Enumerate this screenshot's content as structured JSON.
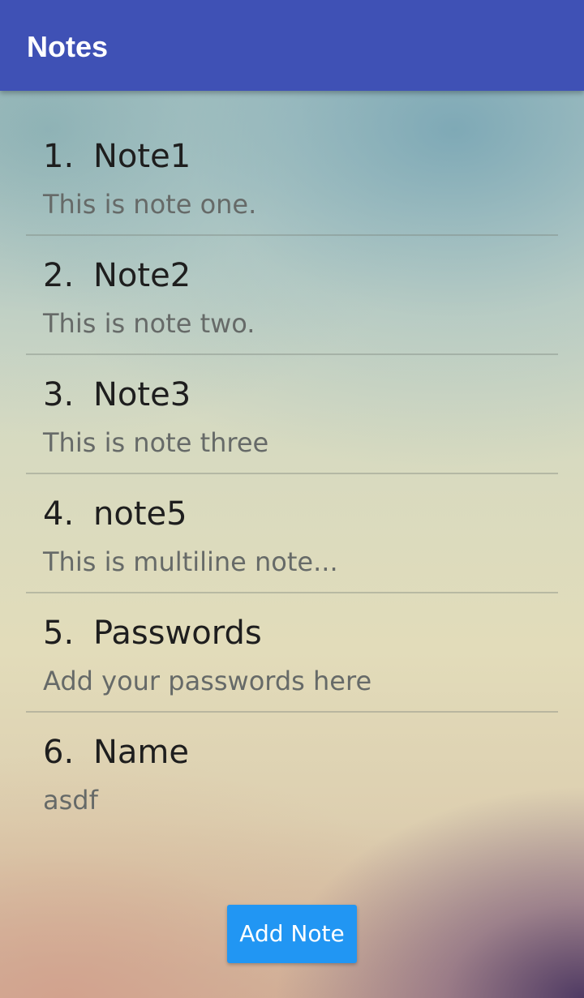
{
  "appbar": {
    "title": "Notes",
    "color": "#3f51b5"
  },
  "notes": [
    {
      "number": "1.",
      "title": "Note1",
      "body": "This is note one."
    },
    {
      "number": "2.",
      "title": "Note2",
      "body": "This is note two."
    },
    {
      "number": "3.",
      "title": "Note3",
      "body": "This is note three"
    },
    {
      "number": "4.",
      "title": "note5",
      "body": "This is multiline note..."
    },
    {
      "number": "5.",
      "title": "Passwords",
      "body": "Add your passwords here"
    },
    {
      "number": "6.",
      "title": "Name",
      "body": "asdf"
    }
  ],
  "actions": {
    "add_note_label": "Add Note",
    "add_note_color": "#2196f3"
  }
}
